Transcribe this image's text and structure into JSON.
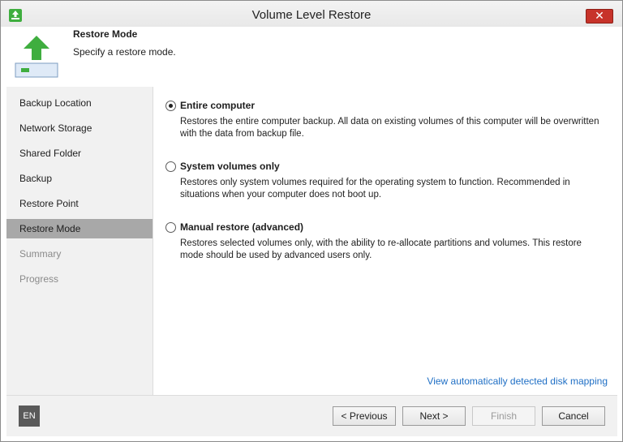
{
  "window": {
    "title": "Volume Level Restore",
    "close_label": "✕"
  },
  "header": {
    "title": "Restore Mode",
    "subtitle": "Specify a restore mode."
  },
  "sidebar": {
    "items": [
      {
        "label": "Backup Location",
        "state": "normal"
      },
      {
        "label": "Network Storage",
        "state": "normal"
      },
      {
        "label": "Shared Folder",
        "state": "normal"
      },
      {
        "label": "Backup",
        "state": "normal"
      },
      {
        "label": "Restore Point",
        "state": "normal"
      },
      {
        "label": "Restore Mode",
        "state": "active"
      },
      {
        "label": "Summary",
        "state": "disabled"
      },
      {
        "label": "Progress",
        "state": "disabled"
      }
    ]
  },
  "options": [
    {
      "label": "Entire computer",
      "description": "Restores the entire computer backup. All data on existing volumes of this computer will be overwritten with the data from backup file.",
      "selected": true
    },
    {
      "label": "System volumes only",
      "description": "Restores only system volumes required for the operating system to function. Recommended in situations when your computer does not boot up.",
      "selected": false
    },
    {
      "label": "Manual restore (advanced)",
      "description": "Restores selected volumes only, with the ability to re-allocate partitions and volumes. This restore mode should be used by advanced users only.",
      "selected": false
    }
  ],
  "link_text": "View automatically detected disk mapping",
  "footer": {
    "language": "EN",
    "previous": "< Previous",
    "next": "Next >",
    "finish": "Finish",
    "cancel": "Cancel"
  },
  "colors": {
    "accent": "#1f6fc5",
    "active_nav": "#a8a8a8",
    "icon_green": "#3fae3f",
    "close_red": "#c7332a"
  }
}
